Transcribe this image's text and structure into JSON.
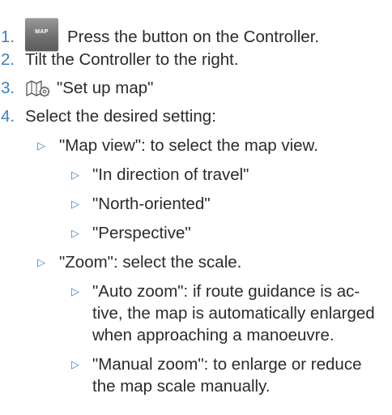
{
  "steps": [
    {
      "num": "1.",
      "text": "Press the button on the Controller.",
      "button_label": "MAP"
    },
    {
      "num": "2.",
      "text": "Tilt the Controller to the right."
    },
    {
      "num": "3.",
      "text": "\"Set up map\"",
      "icon": "map-settings-icon"
    },
    {
      "num": "4.",
      "text": "Select the desired setting:"
    }
  ],
  "settings": [
    {
      "text": "\"Map view\": to select the map view.",
      "options": [
        "\"In direction of travel\"",
        "\"North-oriented\"",
        "\"Perspective\""
      ]
    },
    {
      "text": "\"Zoom\": select the scale.",
      "options": [
        {
          "lines": [
            "\"Auto zoom\": if route guidance is ac-",
            "tive, the map is automatically enlarged",
            "when approaching a manoeuvre."
          ]
        },
        {
          "lines": [
            "\"Manual zoom\": to enlarge or reduce",
            "the map scale manually."
          ]
        }
      ]
    }
  ],
  "bullet_glyph": "▷",
  "colors": {
    "accent": "#3f7fbf",
    "text": "#2b2b2b"
  }
}
